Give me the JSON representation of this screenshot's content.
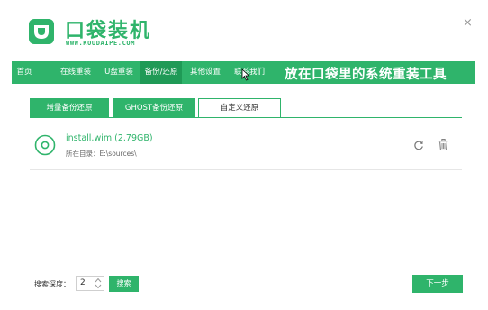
{
  "app": {
    "brand_title": "口袋装机",
    "brand_subtitle": "WWW.KOUDAIPE.COM",
    "minimize_glyph": "–",
    "close_glyph": "×",
    "accent_color": "#2fb46b"
  },
  "nav": {
    "items": [
      {
        "label": "首页",
        "active": false
      },
      {
        "label": "在线重装",
        "active": false
      },
      {
        "label": "U盘重装",
        "active": false
      },
      {
        "label": "备份/还原",
        "active": true
      },
      {
        "label": "其他设置",
        "active": false
      },
      {
        "label": "联系我们",
        "active": false
      }
    ],
    "slogan": "放在口袋里的系统重装工具"
  },
  "tabs": [
    {
      "label": "增量备份还原",
      "selected": false
    },
    {
      "label": "GHOST备份还原",
      "selected": false
    },
    {
      "label": "自定义还原",
      "selected": true
    }
  ],
  "files": [
    {
      "name": "install.wim (2.79GB)",
      "directory": "所在目录：E:\\sources\\",
      "icon": "disc-icon"
    }
  ],
  "footer": {
    "depth_label": "搜索深度：",
    "depth_value": "2",
    "search_button": "搜索",
    "next_button": "下一步"
  }
}
